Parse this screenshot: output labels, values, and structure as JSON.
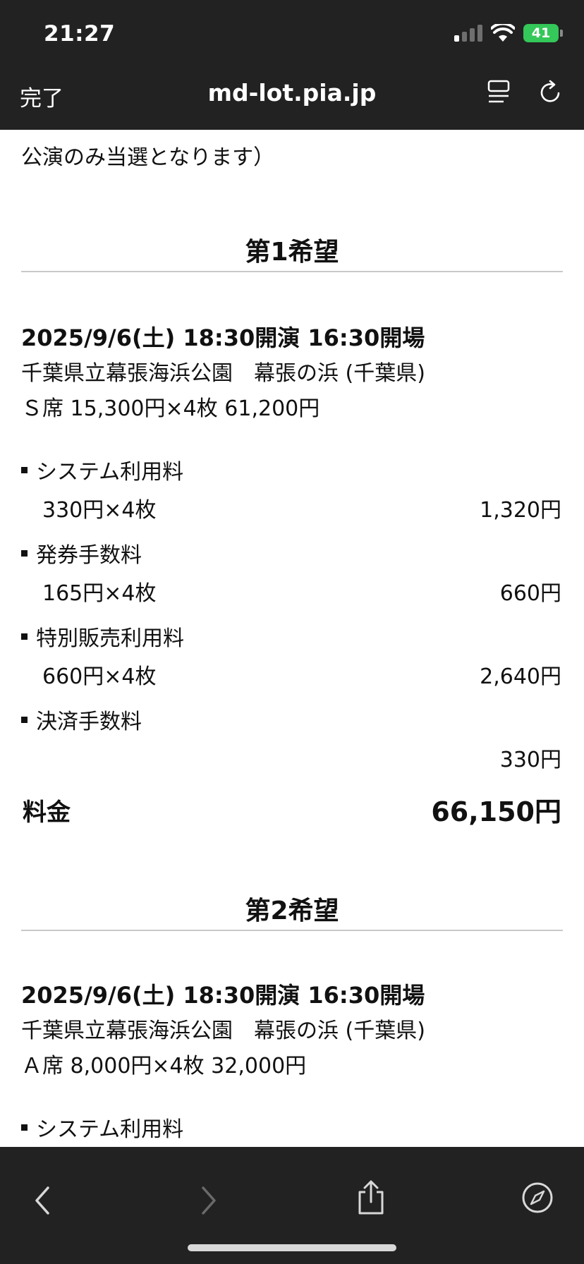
{
  "status": {
    "time": "21:27",
    "battery": "41"
  },
  "nav": {
    "done": "完了",
    "url": "md-lot.pia.jp"
  },
  "lead_text": "公演のみ当選となります）",
  "first": {
    "title": "第1希望",
    "date": "2025/9/6(土) 18:30開演 16:30開場",
    "venue": "千葉県立幕張海浜公園　幕張の浜 (千葉県)",
    "seat": "Ｓ席 15,300円×4枚 61,200円",
    "fees": [
      {
        "label": "システム利用料",
        "detail": "330円×4枚",
        "amount": "1,320円"
      },
      {
        "label": "発券手数料",
        "detail": "165円×4枚",
        "amount": "660円"
      },
      {
        "label": "特別販売利用料",
        "detail": "660円×4枚",
        "amount": "2,640円"
      },
      {
        "label": "決済手数料",
        "detail": "",
        "amount": "330円"
      }
    ],
    "total_label": "料金",
    "total": "66,150円"
  },
  "second": {
    "title": "第2希望",
    "date": "2025/9/6(土) 18:30開演 16:30開場",
    "venue": "千葉県立幕張海浜公園　幕張の浜 (千葉県)",
    "seat": "Ａ席 8,000円×4枚 32,000円",
    "fees": [
      {
        "label": "システム利用料"
      }
    ]
  },
  "icons": {
    "reader": "reader-icon",
    "reload": "reload-icon",
    "back": "back-chevron-icon",
    "forward": "forward-chevron-icon",
    "share": "share-icon",
    "safari": "compass-icon"
  }
}
